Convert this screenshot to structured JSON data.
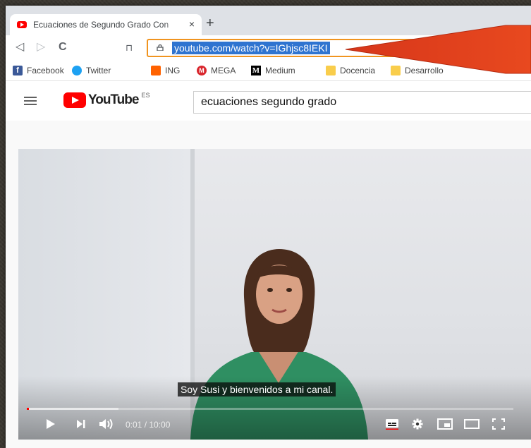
{
  "tab": {
    "title": "Ecuaciones de Segundo Grado Con",
    "close": "×",
    "new_tab": "+"
  },
  "toolbar": {
    "back": "◁",
    "forward": "▷",
    "reload": "C",
    "bookmark": "⊓",
    "url": "youtube.com/watch?v=IGhjsc8IEKI"
  },
  "bookmarks": [
    {
      "label": "Facebook",
      "icon": "facebook-icon",
      "color": "#3b5998"
    },
    {
      "label": "Twitter",
      "icon": "twitter-icon",
      "color": "#1da1f2"
    },
    {
      "label": "ING",
      "icon": "ing-icon",
      "color": "#ff6200"
    },
    {
      "label": "MEGA",
      "icon": "mega-icon",
      "color": "#d9272e"
    },
    {
      "label": "Medium",
      "icon": "medium-icon",
      "color": "#000000"
    },
    {
      "label": "Docencia",
      "icon": "folder-icon",
      "color": "#f9cd4b"
    },
    {
      "label": "Desarrollo",
      "icon": "folder-icon",
      "color": "#f9cd4b"
    }
  ],
  "youtube": {
    "wordmark": "YouTube",
    "region": "ES",
    "search_value": "ecuaciones segundo grado"
  },
  "video": {
    "caption": "Soy Susi y bienvenidos a mi canal.",
    "time": "0:01 / 10:00",
    "progress_fraction": 0.0017
  },
  "colors": {
    "omnibox_highlight": "#f0941f",
    "url_selection": "#2f74d0",
    "annotation_arrow": "#e0401c"
  }
}
